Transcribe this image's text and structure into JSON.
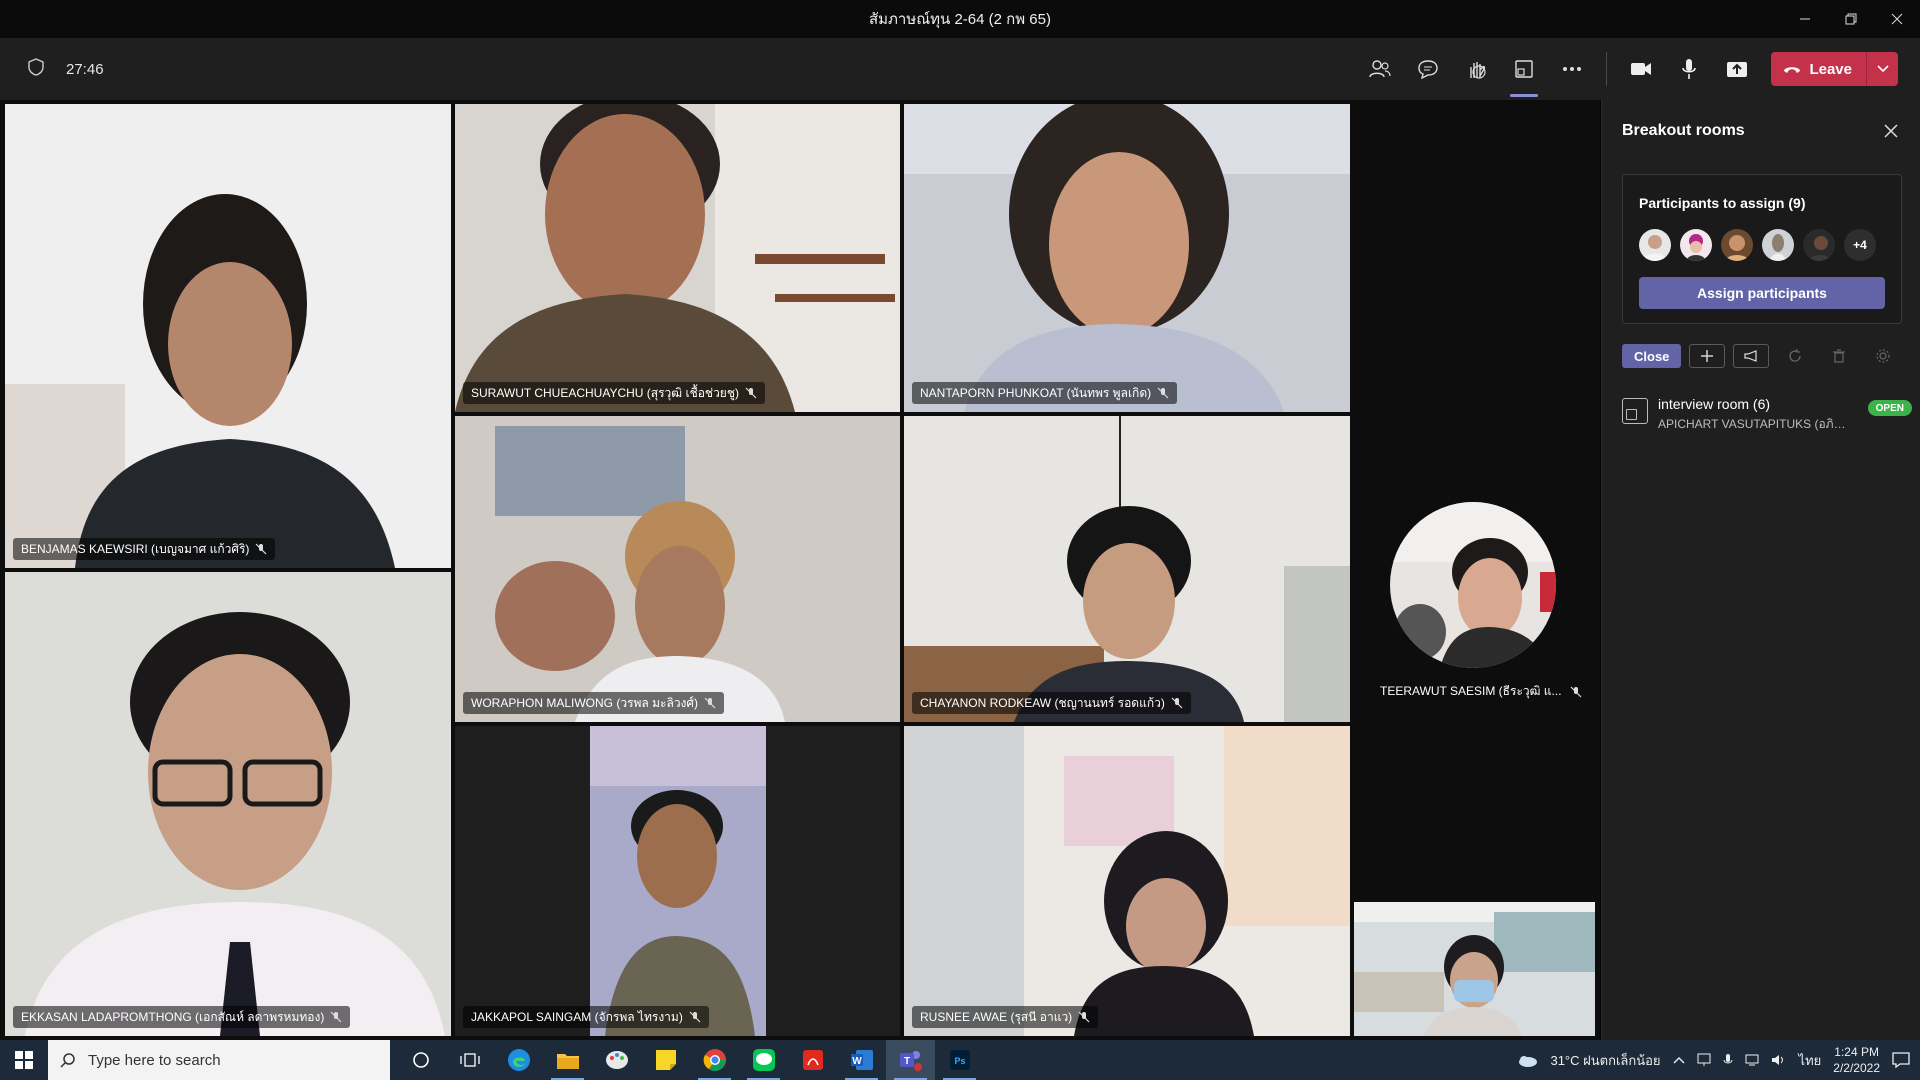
{
  "window": {
    "title": "สัมภาษณ์ทุน 2-64 (2 กพ 65)"
  },
  "toolbar": {
    "timer": "27:46",
    "leave_label": "Leave"
  },
  "participants": [
    {
      "name": "BENJAMAS KAEWSIRI (เบญจมาศ แก้วศิริ)"
    },
    {
      "name": "SURAWUT CHUEACHUAYCHU (สุรวุฒิ เชื้อช่วยชู)"
    },
    {
      "name": "NANTAPORN PHUNKOAT (นันทพร พูลเกิด)"
    },
    {
      "name": "EKKASAN LADAPROMTHONG (เอกสัณห์ ลดาพรหมทอง)"
    },
    {
      "name": "WORAPHON MALIWONG (วรพล มะลิวงศ์)"
    },
    {
      "name": "CHAYANON RODKEAW (ชญานนทร์ รอดแก้ว)"
    },
    {
      "name": "JAKKAPOL SAINGAM (จักรพล ไทรงาม)"
    },
    {
      "name": "RUSNEE AWAE (รุสนี อาแว)"
    },
    {
      "name": "TEERAWUT SAESIM (ธีระวุฒิ แ..."
    }
  ],
  "breakout": {
    "title": "Breakout rooms",
    "assign_label": "Participants to assign (9)",
    "more_count": "+4",
    "assign_button": "Assign participants",
    "close_button": "Close",
    "room": {
      "name": "interview room  (6)",
      "sub": "APICHART VASUTAPITUKS (อภิช...",
      "status": "OPEN"
    }
  },
  "taskbar": {
    "search_placeholder": "Type here to search",
    "weather": "31°C  ฝนตกเล็กน้อย",
    "lang": "ไทย",
    "time": "1:24 PM",
    "date": "2/2/2022"
  },
  "colors": {
    "accent": "#6264a7",
    "leave": "#c4314b",
    "open": "#3cb34a"
  }
}
